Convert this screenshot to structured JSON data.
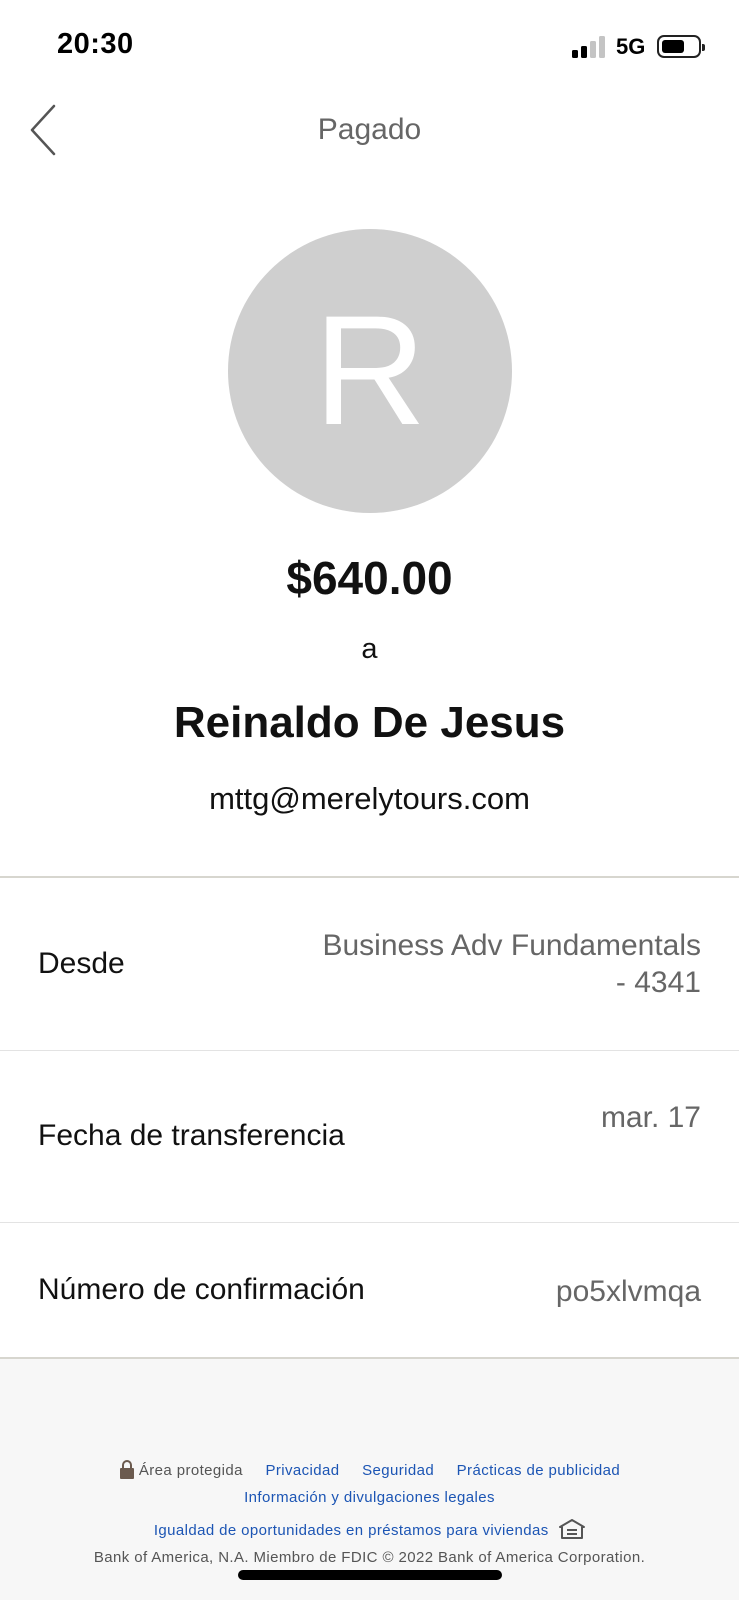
{
  "status_bar": {
    "time": "20:30",
    "network": "5G",
    "signal_bars_active": 2,
    "battery_level": 0.6
  },
  "header": {
    "title": "Pagado",
    "back_icon": "chevron-left-icon"
  },
  "recipient": {
    "initial": "R",
    "amount": "$640.00",
    "to_word": "a",
    "name": "Reinaldo De Jesus",
    "email": "mttg@merelytours.com"
  },
  "details": {
    "from_label": "Desde",
    "from_value_line1": "Business Adv Fundamentals",
    "from_value_line2": "- 4341",
    "date_label": "Fecha de transferencia",
    "date_value": "mar. 17",
    "confirmation_label": "Número de confirmación",
    "confirmation_value": "po5xlvmqa"
  },
  "footer": {
    "secure_area": "Área protegida",
    "privacy": "Privacidad",
    "security": "Seguridad",
    "ad_practices": "Prácticas de publicidad",
    "legal": "Información y divulgaciones legales",
    "equal_housing": "Igualdad de oportunidades en préstamos para viviendas",
    "copyright": "Bank of America, N.A. Miembro de FDIC © 2022 Bank of America Corporation."
  },
  "colors": {
    "link": "#1c55b4",
    "avatar_bg": "#cfcfcf",
    "footer_bg": "#f7f7f7"
  }
}
